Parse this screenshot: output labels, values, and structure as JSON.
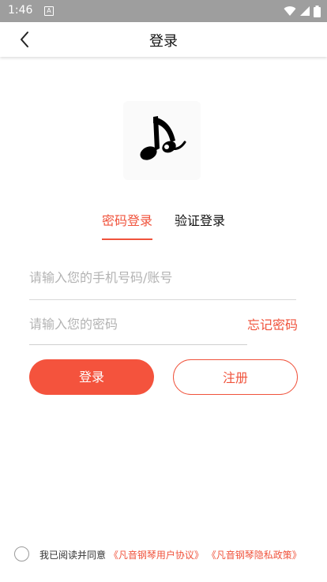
{
  "status": {
    "time": "1:46",
    "notification_glyph": "A",
    "icons": [
      "wifi-icon",
      "signal-icon",
      "battery-icon"
    ]
  },
  "header": {
    "title": "登录",
    "back_icon": "chevron-left-icon"
  },
  "logo": {
    "icon": "music-note-icon"
  },
  "tabs": [
    {
      "label": "密码登录",
      "active": true
    },
    {
      "label": "验证登录",
      "active": false
    }
  ],
  "form": {
    "account_placeholder": "请输入您的手机号码/账号",
    "account_value": "",
    "password_placeholder": "请输入您的密码",
    "password_value": "",
    "forgot_label": "忘记密码",
    "login_label": "登录",
    "register_label": "注册"
  },
  "agreement": {
    "prefix": "我已阅读并同意",
    "user_agreement": "《凡音钢琴用户协议》",
    "privacy_policy": "《凡音钢琴隐私政策》",
    "checked": false
  },
  "colors": {
    "accent": "#f0533c",
    "status_bar": "#9e9e9e"
  }
}
